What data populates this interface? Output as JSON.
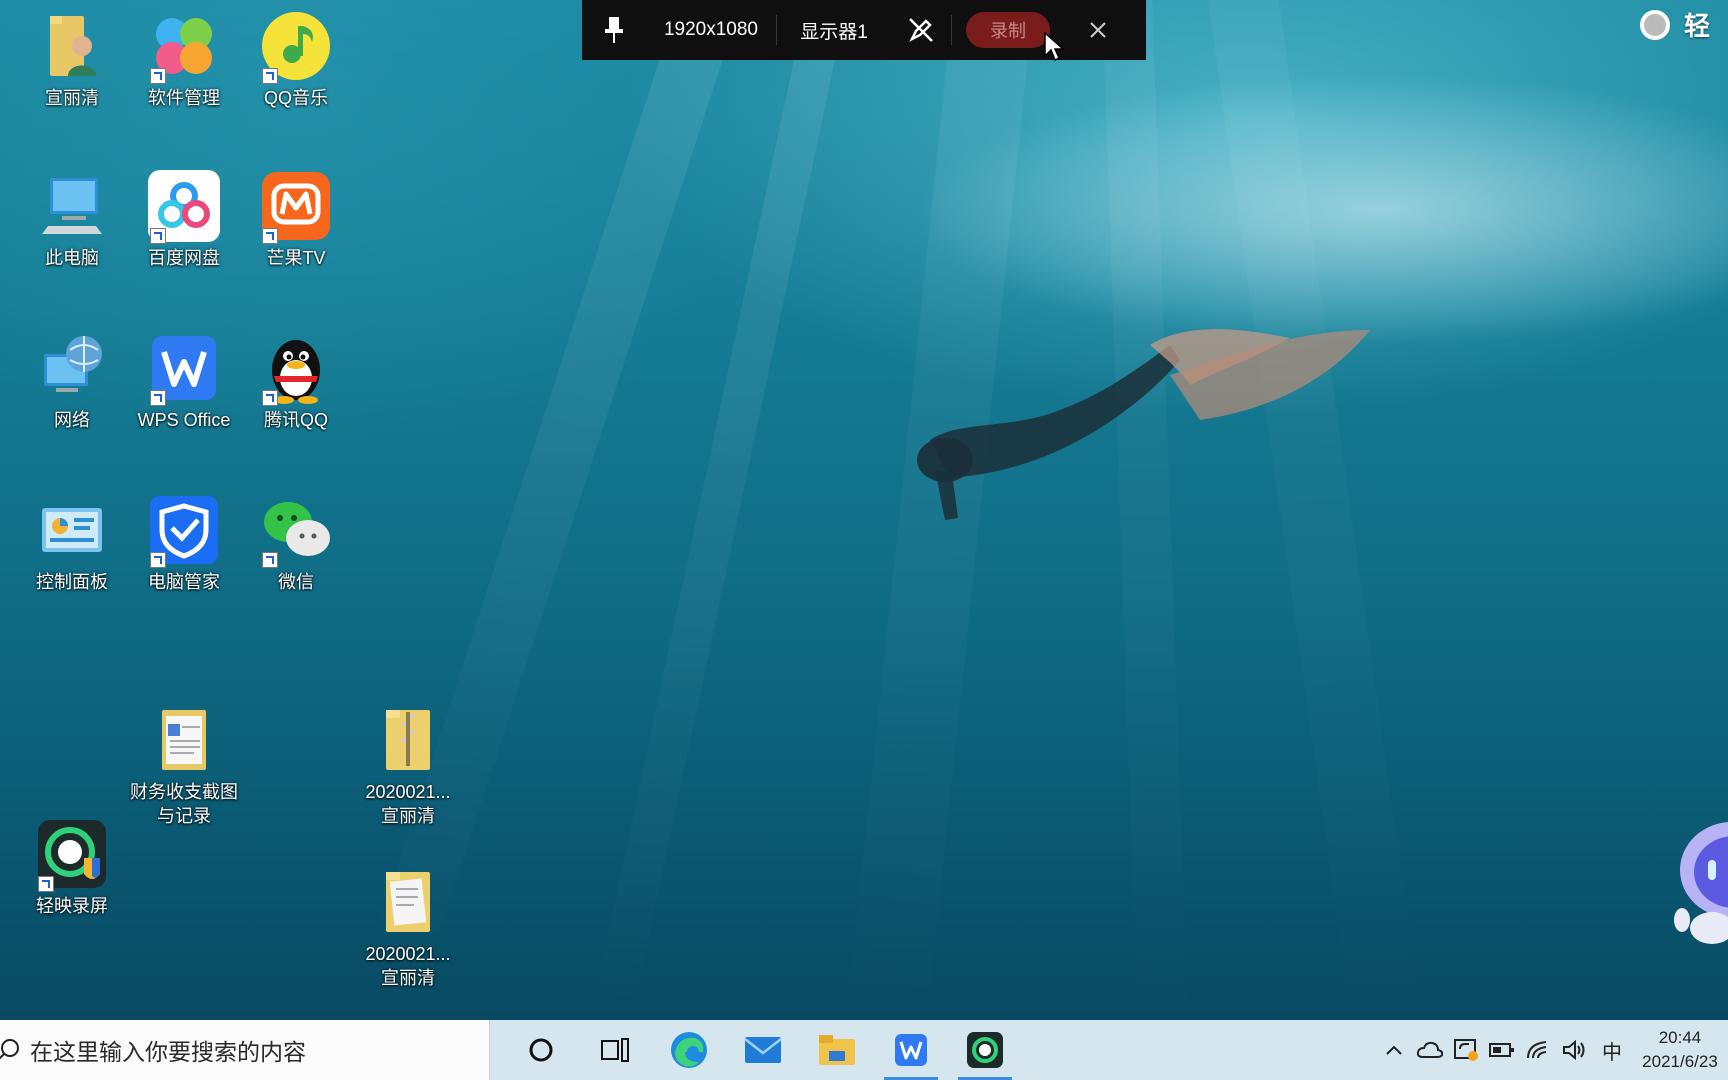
{
  "desktop": {
    "icons": [
      {
        "label": "宣丽清",
        "icon": "user-folder-icon"
      },
      {
        "label": "软件管理",
        "icon": "software-manager-icon"
      },
      {
        "label": "QQ音乐",
        "icon": "qq-music-icon"
      },
      {
        "label": "此电脑",
        "icon": "this-pc-icon"
      },
      {
        "label": "百度网盘",
        "icon": "baidu-netdisk-icon"
      },
      {
        "label": "芒果TV",
        "icon": "mango-tv-icon"
      },
      {
        "label": "网络",
        "icon": "network-icon"
      },
      {
        "label": "WPS Office",
        "icon": "wps-office-icon"
      },
      {
        "label": "腾讯QQ",
        "icon": "tencent-qq-icon"
      },
      {
        "label": "控制面板",
        "icon": "control-panel-icon"
      },
      {
        "label": "电脑管家",
        "icon": "pc-manager-icon"
      },
      {
        "label": "微信",
        "icon": "wechat-icon"
      },
      {
        "label": "财务收支截图\n与记录",
        "icon": "document-folder-icon"
      },
      {
        "label": "2020021...\n宣丽清",
        "icon": "zip-folder-icon"
      },
      {
        "label": "轻映录屏",
        "icon": "qingying-recorder-icon"
      },
      {
        "label": "2020021...\n宣丽清",
        "icon": "document-folder-icon"
      }
    ],
    "corner_label": "轻"
  },
  "recorder_toolbar": {
    "pin_icon": "pin-icon",
    "resolution": "1920x1080",
    "display": "显示器1",
    "pen_off_icon": "pen-off-icon",
    "record_label": "录制",
    "close_icon": "close-icon"
  },
  "taskbar": {
    "search_placeholder": "在这里输入你要搜索的内容",
    "apps": [
      "cortana-icon",
      "task-view-icon",
      "edge-icon",
      "mail-icon",
      "file-explorer-icon",
      "wps-icon",
      "qingying-recorder-icon"
    ],
    "tray": {
      "ime": "中",
      "time": "20:44",
      "date": "2021/6/23"
    }
  },
  "colors": {
    "toolbar_bg": "#0f0f10",
    "record_button": "#7a1c1c",
    "taskbar_bg": "#d6e6ee",
    "active_indicator": "#3a8ee6"
  }
}
